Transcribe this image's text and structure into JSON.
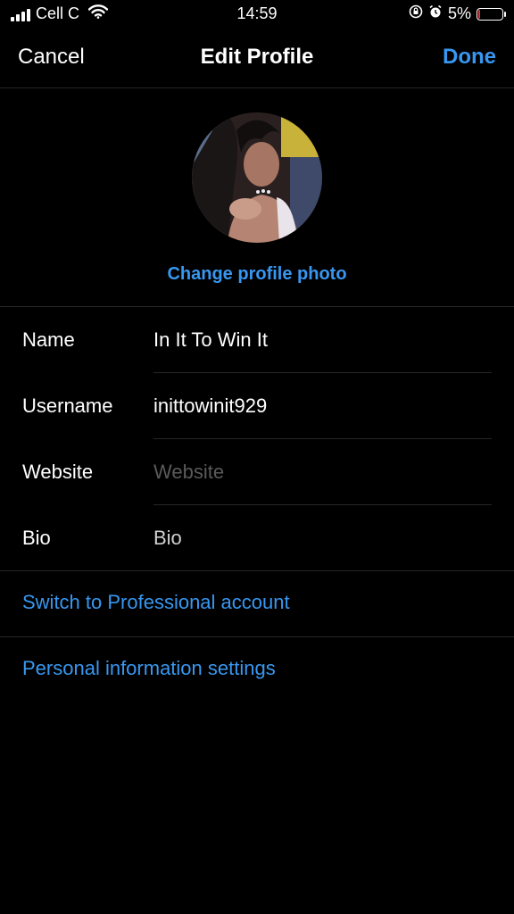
{
  "status_bar": {
    "carrier": "Cell C",
    "time": "14:59",
    "battery_percent": "5%",
    "battery_level": 0.05,
    "icons": [
      "signal-icon",
      "wifi-icon",
      "orientation-lock-icon",
      "alarm-icon",
      "battery-icon"
    ],
    "battery_color": "#e0353b"
  },
  "nav": {
    "cancel_label": "Cancel",
    "title": "Edit Profile",
    "done_label": "Done"
  },
  "profile": {
    "change_photo_label": "Change profile photo"
  },
  "fields": [
    {
      "label": "Name",
      "value": "In It To Win It",
      "placeholder": "Name"
    },
    {
      "label": "Username",
      "value": "inittowinit929",
      "placeholder": "Username"
    },
    {
      "label": "Website",
      "value": "",
      "placeholder": "Website"
    },
    {
      "label": "Bio",
      "value": "",
      "placeholder": "Bio"
    }
  ],
  "links": {
    "professional": "Switch to Professional account",
    "personal_info": "Personal information settings"
  },
  "colors": {
    "accent": "#3897f0",
    "background": "#000000",
    "divider": "#262626"
  }
}
